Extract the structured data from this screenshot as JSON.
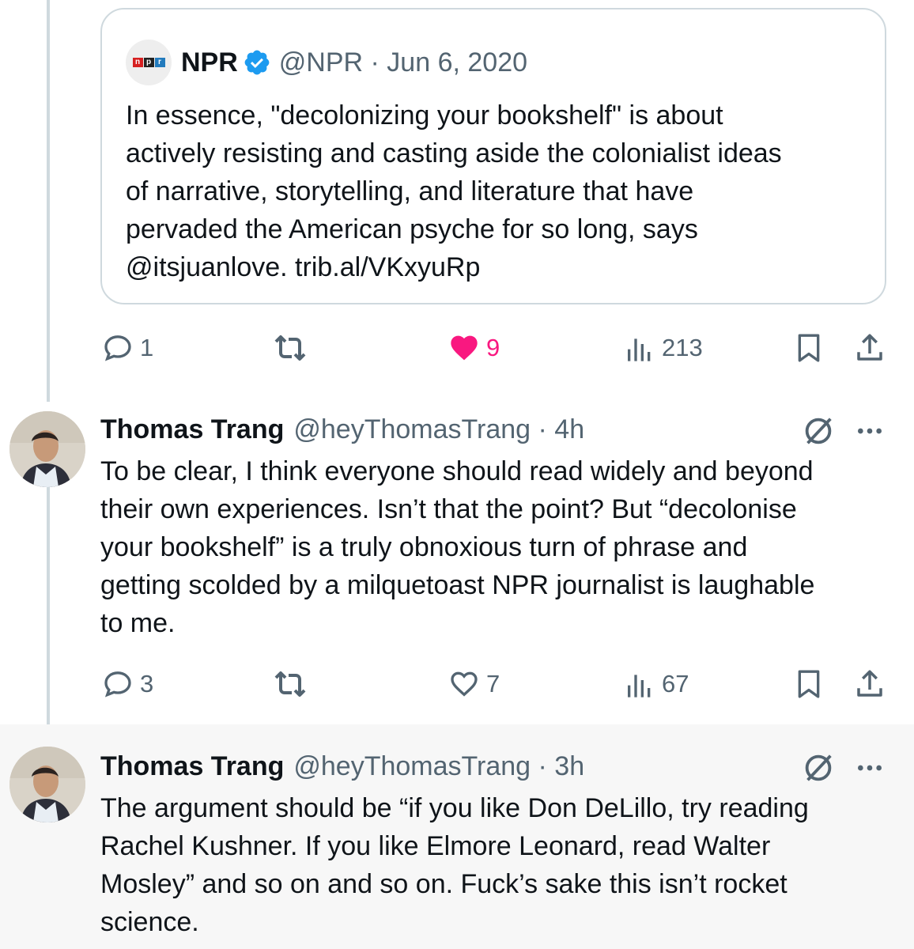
{
  "colors": {
    "text_primary": "#0f1419",
    "text_secondary": "#536471",
    "like_active": "#f91880",
    "verified_blue": "#1d9bf0",
    "border": "#cfd9de",
    "highlight_bg": "#f7f7f7"
  },
  "quoted_tweet": {
    "logo_letters": [
      "n",
      "p",
      "r"
    ],
    "author_name": "NPR",
    "verified_icon": "verified-badge-icon",
    "meta": "@NPR · Jun 6, 2020",
    "text": "In essence, \"decolonizing your bookshelf\" is about\nactively resisting and casting aside the colonialist ideas\nof narrative, storytelling, and literature that have\npervaded the American psyche for so long, says\n@itsjuanlove. trib.al/VKxyuRp"
  },
  "tweet_1_actions": {
    "replies": "1",
    "reposts": "",
    "likes": "9",
    "liked": true,
    "views": "213"
  },
  "reply_1": {
    "name": "Thomas Trang",
    "meta": "@heyThomasTrang · 4h",
    "text": "To be clear, I think everyone should read widely and beyond\ntheir own experiences. Isn’t that the point? But “decolonise\nyour bookshelf” is a truly obnoxious turn of phrase and\ngetting scolded by a milquetoast NPR journalist is laughable\nto me.",
    "actions": {
      "replies": "3",
      "reposts": "",
      "likes": "7",
      "views": "67"
    }
  },
  "reply_2": {
    "name": "Thomas Trang",
    "meta": "@heyThomasTrang · 3h",
    "text": "The argument should be “if you like Don DeLillo, try reading\nRachel Kushner. If you like Elmore Leonard, read Walter\nMosley” and so on and so on. Fuck’s sake this isn’t rocket\nscience."
  },
  "icons": {
    "reply": "speech-bubble-icon",
    "repost": "repost-arrows-icon",
    "like": "heart-icon",
    "views": "bar-chart-icon",
    "bookmark": "bookmark-icon",
    "share": "share-upload-icon",
    "grok": "grok-slash-icon",
    "more": "more-dots-icon"
  }
}
